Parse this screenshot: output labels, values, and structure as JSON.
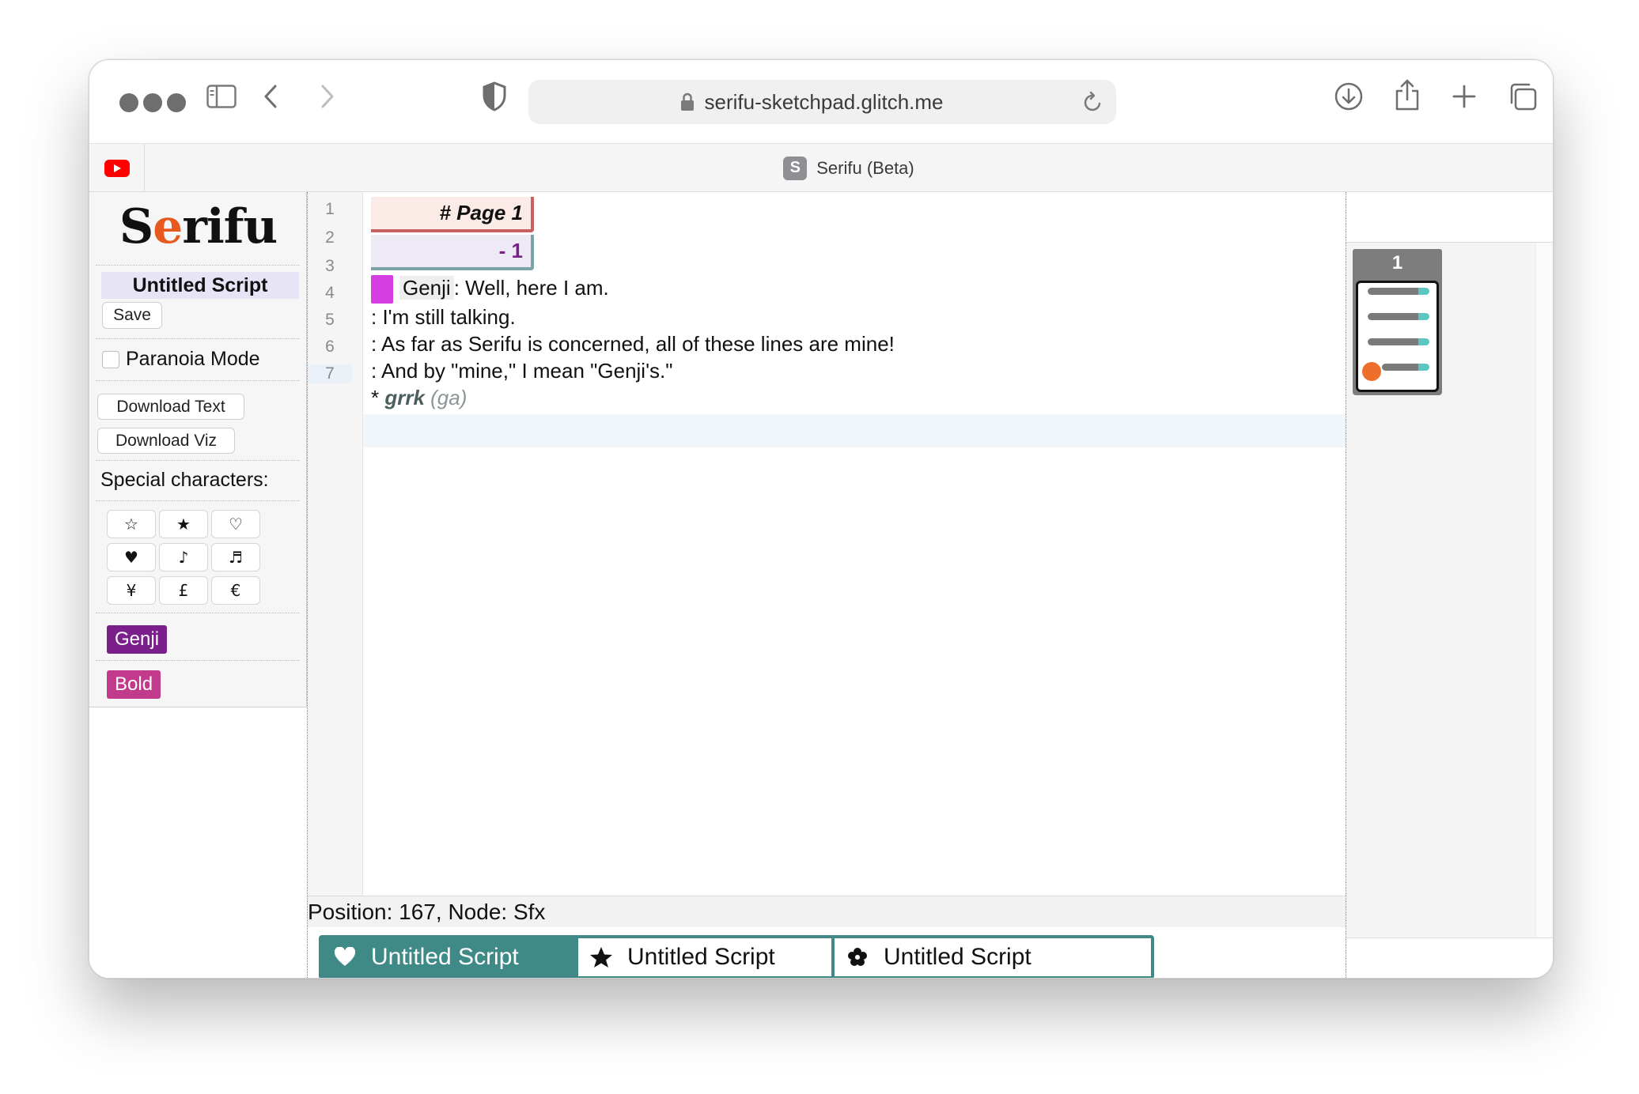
{
  "browser": {
    "url": "serifu-sketchpad.glitch.me",
    "tabs": [
      {
        "title": "Serifu (Beta)",
        "favicon_letter": "S"
      }
    ],
    "icons": [
      "sidebar-icon",
      "back-icon",
      "forward-icon",
      "shield-icon",
      "lock-icon",
      "reload-icon",
      "download-icon",
      "share-icon",
      "new-tab-icon",
      "tab-overview-icon",
      "youtube-icon"
    ]
  },
  "sidebar": {
    "logo_before": "S",
    "logo_dot": "e",
    "logo_after": "rifu",
    "script_title": "Untitled Script",
    "save_label": "Save",
    "paranoia_label": "Paranoia Mode",
    "paranoia_checked": false,
    "download_text_label": "Download Text",
    "download_viz_label": "Download Viz",
    "special_chars_label": "Special characters:",
    "special_chars": [
      "☆",
      "★",
      "♡",
      "♥",
      "♪",
      "♬",
      "¥",
      "£",
      "€"
    ],
    "tags": [
      {
        "label": "Genji",
        "color": "#7b1f8c"
      },
      {
        "label": "Bold",
        "color": "#c23a8c"
      }
    ]
  },
  "editor": {
    "line_numbers": [
      "1",
      "2",
      "3",
      "4",
      "5",
      "6",
      "7"
    ],
    "active_line": 7,
    "page_heading": "# Page 1",
    "panel_marker": "- 1",
    "line3_character": "Genji",
    "line3_text": ": Well, here I am.",
    "line4": ": I'm still talking.",
    "line5": ": As far as Serifu is concerned, all of these lines are mine!",
    "line6": ": And by \"mine,\" I mean \"Genji's.\"",
    "line7_star": "* ",
    "line7_sfx": "grrk",
    "line7_paren": " (ga)",
    "character_color": "#d53ee0",
    "status": "Position: 167, Node: Sfx"
  },
  "script_tabs": [
    {
      "label": "Untitled Script",
      "icon": "heart-icon",
      "active": true
    },
    {
      "label": "Untitled Script",
      "icon": "star-icon",
      "active": false
    },
    {
      "label": "Untitled Script",
      "icon": "flower-icon",
      "active": false
    }
  ],
  "right_panel": {
    "page_thumb_label": "1",
    "thumb_bars": 4
  },
  "colors": {
    "accent_teal": "#3f8a87",
    "orange_dot": "#f06e2b"
  }
}
